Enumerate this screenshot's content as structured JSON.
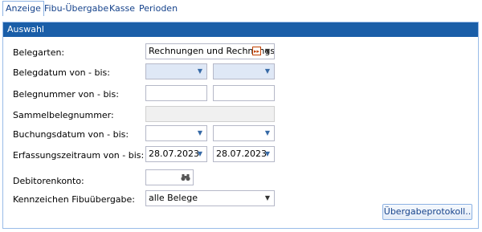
{
  "tabs": [
    {
      "label": "Anzeige"
    },
    {
      "label": "Fibu-Übergabe"
    },
    {
      "label": "Kasse"
    },
    {
      "label": "Perioden"
    }
  ],
  "panel": {
    "title": "Auswahl"
  },
  "form": {
    "belegarten": {
      "label": "Belegarten:",
      "value": "Rechnungen und Rechnungs"
    },
    "belegdatum": {
      "label": "Belegdatum von - bis:",
      "from": "",
      "to": ""
    },
    "belegnummer": {
      "label": "Belegnummer von - bis:",
      "from": "",
      "to": ""
    },
    "sammelbelegnummer": {
      "label": "Sammelbelegnummer:",
      "value": ""
    },
    "buchungsdatum": {
      "label": "Buchungsdatum von - bis:",
      "from": "",
      "to": ""
    },
    "erfassungszeitraum": {
      "label": "Erfassungszeitraum von - bis:",
      "from": "28.07.2023",
      "to": "28.07.2023"
    },
    "debitorenkonto": {
      "label": "Debitorenkonto:",
      "value": ""
    },
    "kennzeichen": {
      "label": "Kennzeichen Fibuübergabe:",
      "value": "alle Belege"
    }
  },
  "buttons": {
    "protocol": "Übergabeprotokoll.."
  },
  "icons": {
    "dropdown": "chevron-down-icon",
    "nav": "fast-forward-icon",
    "search": "binoculars-icon"
  },
  "colors": {
    "header": "#1a5ea8",
    "tab_text": "#15428b",
    "date_empty": "#dfe8f6"
  }
}
